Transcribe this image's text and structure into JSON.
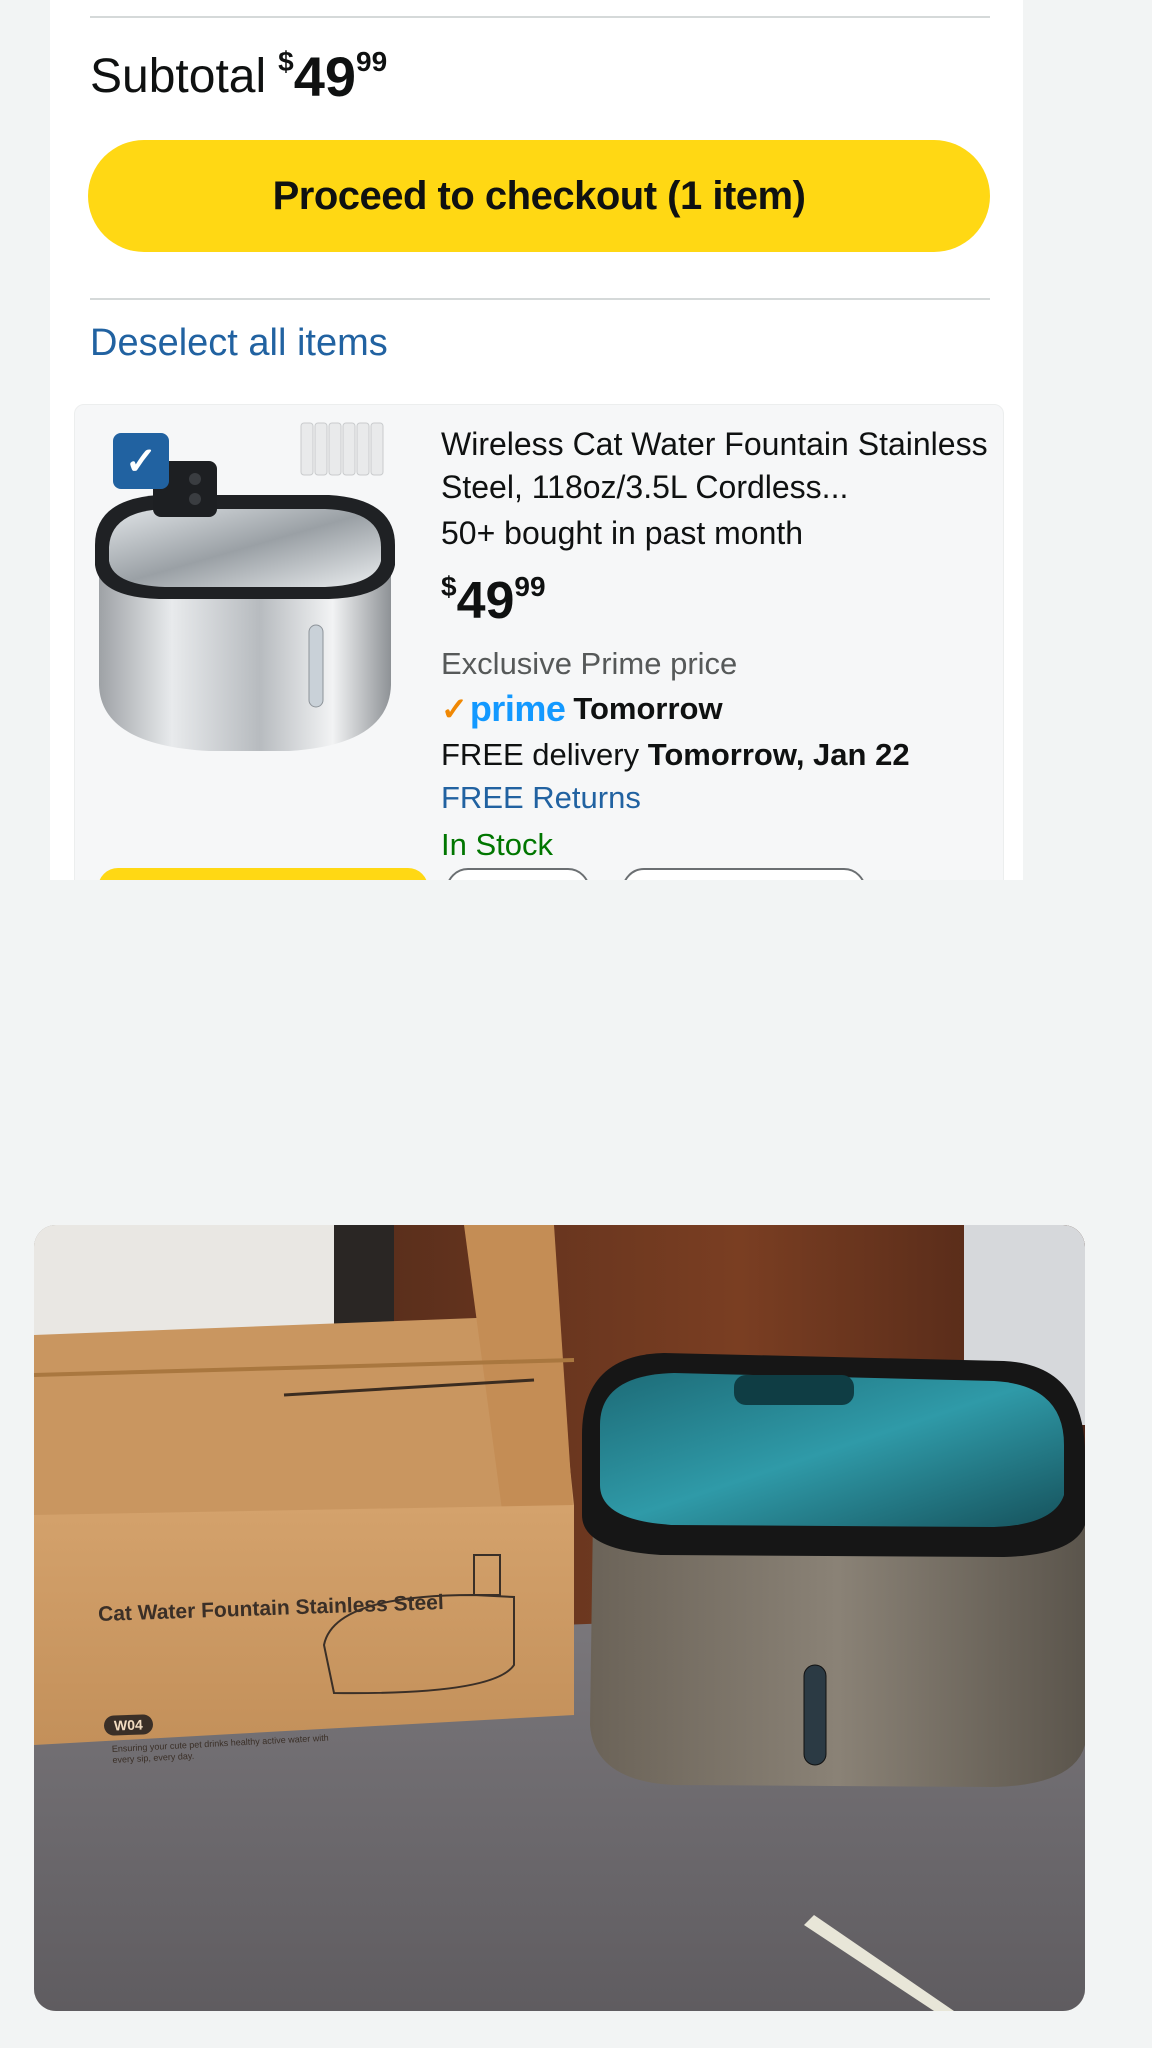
{
  "cart": {
    "subtotal_label": "Subtotal",
    "subtotal_price": {
      "currency": "$",
      "whole": "49",
      "fraction": "99"
    },
    "checkout_label": "Proceed to checkout (1 item)",
    "deselect_label": "Deselect all items"
  },
  "item": {
    "selected": true,
    "title": "Wireless Cat Water Fountain Stainless Steel, 118oz/3.5L Cordless...",
    "bought": "50+ bought in past month",
    "price": {
      "currency": "$",
      "whole": "49",
      "fraction": "99"
    },
    "prime_price_note": "Exclusive Prime price",
    "prime_logo": "prime",
    "prime_delivery": "Tomorrow",
    "delivery_prefix": "FREE delivery",
    "delivery_date": "Tomorrow, Jan 22",
    "returns": "FREE Returns",
    "stock": "In Stock"
  },
  "photo": {
    "box_text": "Cat Water Fountain Stainless Steel",
    "box_code": "W04",
    "box_tagline": "Ensuring your cute pet drinks healthy active water with every sip, every day."
  },
  "colors": {
    "checkout_yellow": "#ffd814",
    "link_blue": "#2162a1",
    "in_stock_green": "#007600",
    "prime_blue": "#1399ff",
    "prime_check_orange": "#f08804"
  },
  "icons": {
    "checkbox": "checkmark-icon",
    "prime_check": "prime-check-icon"
  }
}
